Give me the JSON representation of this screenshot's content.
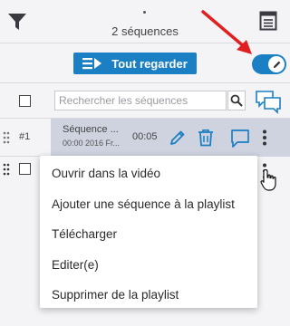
{
  "header": {
    "sequence_count": "2 séquences"
  },
  "actions": {
    "watch_all_label": "Tout regarder",
    "edit_toggle_on": true
  },
  "search": {
    "placeholder": "Rechercher les séquences"
  },
  "sequences": [
    {
      "number": "#1",
      "title": "Séquence ...",
      "meta": "00:00 2016 Fr...",
      "duration": "00:05"
    }
  ],
  "context_menu": {
    "items": [
      "Ouvrir dans la vidéo",
      "Ajouter une séquence à la playlist",
      "Télécharger",
      "Editer(e)",
      "Supprimer de la playlist"
    ]
  },
  "colors": {
    "accent": "#1a7fc3",
    "annotation_arrow": "#e02020",
    "row_highlight": "#cfd3df"
  }
}
